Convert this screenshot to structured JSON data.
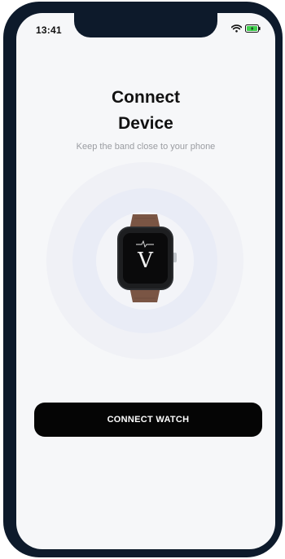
{
  "status_bar": {
    "time": "13:41",
    "icons": [
      "wifi-icon",
      "battery-charging-icon"
    ]
  },
  "main": {
    "title_line1": "Connect",
    "title_line2": "Device",
    "subtitle": "Keep the band close to your phone",
    "watch_logo": "V"
  },
  "actions": {
    "connect_label": "CONNECT WATCH"
  },
  "colors": {
    "frame": "#0d1a2b",
    "screen_bg": "#f6f7f9",
    "button_bg": "#050505",
    "battery_green": "#3ecf4c",
    "strap_brown": "#7a5544"
  }
}
